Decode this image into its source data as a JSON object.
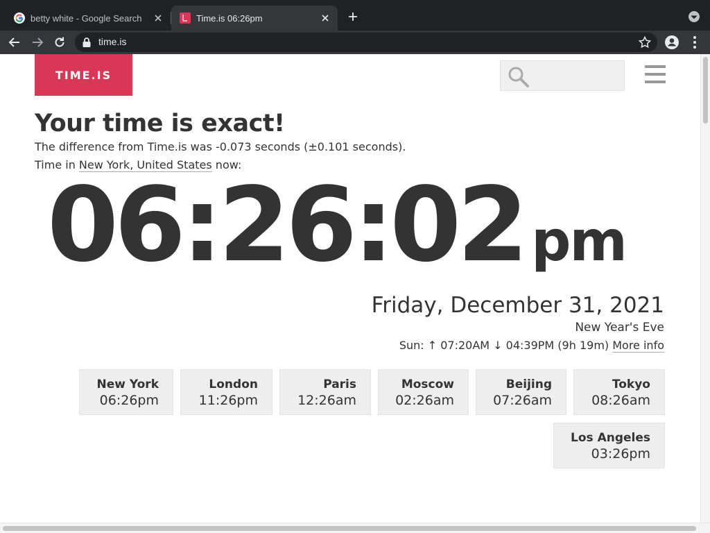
{
  "browser": {
    "tabs": [
      {
        "title": "betty white - Google Search",
        "active": false,
        "favicon": "google-g-icon"
      },
      {
        "title": "Time.is 06:26pm",
        "active": true,
        "favicon": "timeis-icon"
      }
    ],
    "url": "time.is"
  },
  "site": {
    "logo_text": "TIME.IS",
    "search_placeholder": "",
    "brand_color": "#d83755"
  },
  "status": {
    "headline": "Your time is exact!",
    "difference_text": "The difference from Time.is was -0.073 seconds (±0.101 seconds).",
    "time_in_prefix": "Time in",
    "location": "New York, United States",
    "time_in_suffix": "now:"
  },
  "clock": {
    "time": "06:26:02",
    "ampm": "pm"
  },
  "date": {
    "full": "Friday, December 31, 2021",
    "holiday": "New Year's Eve",
    "sun_text": "Sun: ↑ 07:20AM ↓ 04:39PM (9h 19m)",
    "more_info": "More info"
  },
  "cities": [
    {
      "name": "New York",
      "time": "06:26pm"
    },
    {
      "name": "London",
      "time": "11:26pm"
    },
    {
      "name": "Paris",
      "time": "12:26am"
    },
    {
      "name": "Moscow",
      "time": "02:26am"
    },
    {
      "name": "Beijing",
      "time": "07:26am"
    },
    {
      "name": "Tokyo",
      "time": "08:26am"
    },
    {
      "name": "Los Angeles",
      "time": "03:26pm"
    }
  ]
}
